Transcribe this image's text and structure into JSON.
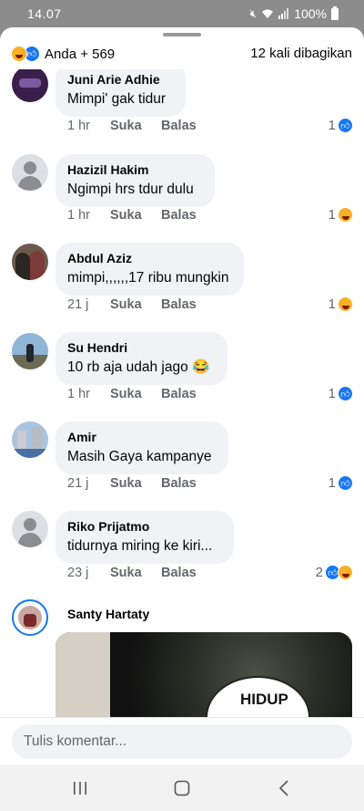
{
  "status_bar": {
    "time": "14.07",
    "battery": "100%"
  },
  "header": {
    "reaction_count": "Anda + 569",
    "shares": "12 kali dibagikan"
  },
  "comments": [
    {
      "author": "Juni Arie Adhie",
      "text": "Mimpi' gak tidur",
      "time": "1 hr",
      "like": "Suka",
      "reply": "Balas",
      "react_count": "1",
      "reactions": [
        "like"
      ]
    },
    {
      "author": "Hazizil Hakim",
      "text": "Ngimpi hrs tdur dulu",
      "time": "1 hr",
      "like": "Suka",
      "reply": "Balas",
      "react_count": "1",
      "reactions": [
        "haha"
      ]
    },
    {
      "author": "Abdul Aziz",
      "text": "mimpi,,,,,,17 ribu mungkin",
      "time": "21 j",
      "like": "Suka",
      "reply": "Balas",
      "react_count": "1",
      "reactions": [
        "haha"
      ]
    },
    {
      "author": "Su Hendri",
      "text": "10 rb aja udah jago 😂",
      "time": "1 hr",
      "like": "Suka",
      "reply": "Balas",
      "react_count": "1",
      "reactions": [
        "like"
      ]
    },
    {
      "author": "Amir",
      "text": "Masih Gaya kampanye",
      "time": "21 j",
      "like": "Suka",
      "reply": "Balas",
      "react_count": "1",
      "reactions": [
        "like"
      ]
    },
    {
      "author": "Riko Prijatmo",
      "text": "tidurnya miring ke kiri...",
      "time": "23 j",
      "like": "Suka",
      "reply": "Balas",
      "react_count": "2",
      "reactions": [
        "like",
        "haha"
      ]
    },
    {
      "author": "Santy Hartaty",
      "image_text": "HIDUP"
    }
  ],
  "composer": {
    "placeholder": "Tulis komentar..."
  },
  "nav": {
    "recents": "recents-icon",
    "home": "home-icon",
    "back": "back-icon"
  }
}
